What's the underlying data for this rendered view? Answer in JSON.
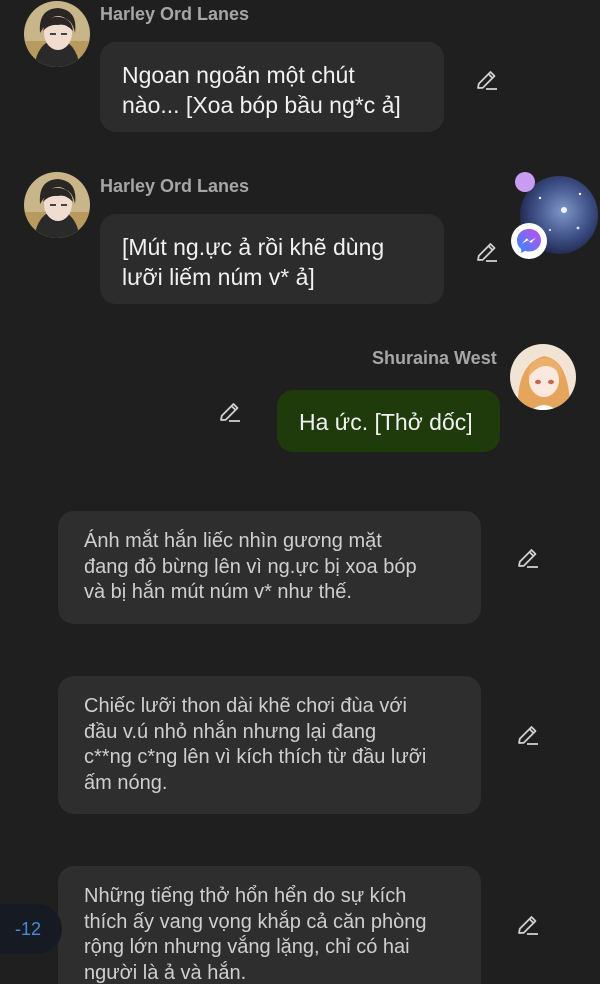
{
  "messages": [
    {
      "sender": "Harley Ord Lanes",
      "text": "Ngoan ngoãn một chút\nnào... [Xoa bóp bầu ng*c ả]"
    },
    {
      "sender": "Harley Ord Lanes",
      "text": "[Mút ng.ực ả rồi khẽ dùng\nlưỡi liếm núm v* ả]"
    },
    {
      "sender": "Shuraina West",
      "text": "Ha ức. [Thở dốc]"
    }
  ],
  "narrations": [
    "Ánh mắt hắn liếc nhìn gương mặt\nđang đỏ bừng lên vì ng.ực bị xoa bóp\nvà bị hắn mút núm v* như thế.",
    "Chiếc lưỡi thon dài khẽ chơi đùa với\nđầu v.ú nhỏ nhắn nhưng lại đang\nc**ng c*ng lên vì kích thích từ đầu lưỡi\nấm nóng.",
    "Những tiếng thở hổn hển do sự kích\nthích ấy vang vọng khắp cả căn phòng\nrộng lớn nhưng vắng lặng, chỉ có hai\nngười là ả và hắn."
  ],
  "icons": {
    "edit": "pencil-edit-icon",
    "messenger": "messenger-icon"
  },
  "counter": "-12",
  "colors": {
    "background": "#1f1f1f",
    "bubble": "#2c2c2c",
    "my_bubble": "#1f3a0b",
    "sender_name": "#a6a6a6",
    "counter_text": "#4a8bd8",
    "messenger_gradient_start": "#2d8cff",
    "messenger_gradient_end": "#c94be8"
  }
}
